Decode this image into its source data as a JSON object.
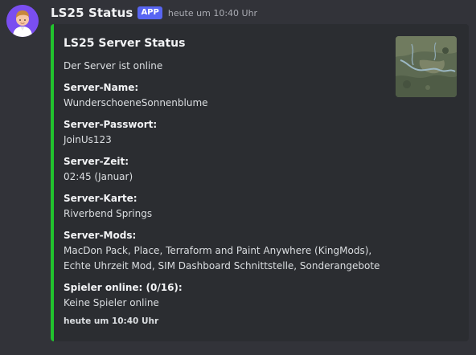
{
  "message": {
    "username": "LS25 Status",
    "app_tag": "APP",
    "timestamp": "heute um 10:40 Uhr",
    "avatar_icon": "person-avatar-icon"
  },
  "embed": {
    "accent_color": "#22c32e",
    "title": "LS25 Server Status",
    "description": "Der Server ist online",
    "thumbnail_icon": "map-thumbnail",
    "fields": [
      {
        "name": "Server-Name:",
        "value": "WunderschoeneSonnenblume"
      },
      {
        "name": "Server-Passwort:",
        "value": "JoinUs123"
      },
      {
        "name": "Server-Zeit:",
        "value": "02:45 (Januar)"
      },
      {
        "name": "Server-Karte:",
        "value": "Riverbend Springs"
      },
      {
        "name": "Server-Mods:",
        "value_lines": [
          "MacDon Pack, Place, Terraform and Paint Anywhere (KingMods),",
          "Echte Uhrzeit Mod, SIM Dashboard Schnittstelle, Sonderangebote"
        ]
      },
      {
        "name": "Spieler online: (0/16):",
        "value": "Keine Spieler online"
      }
    ],
    "footer": "heute um 10:40 Uhr"
  },
  "colors": {
    "background": "#323339",
    "embed_background": "#2b2d31",
    "app_tag": "#5865f2",
    "avatar": "#7a4ef0"
  }
}
